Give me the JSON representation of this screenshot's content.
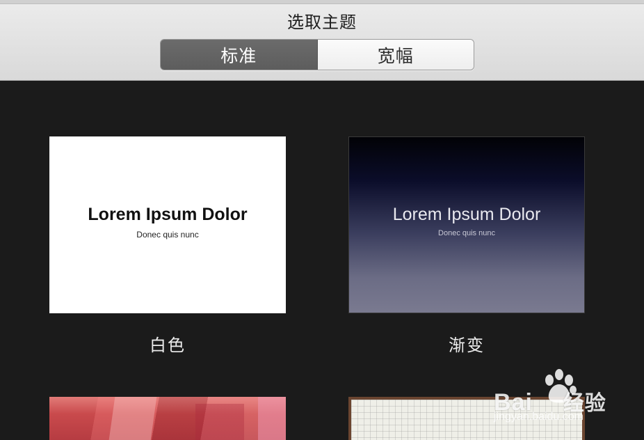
{
  "header": {
    "title": "选取主题",
    "segments": [
      {
        "label": "标准",
        "selected": true
      },
      {
        "label": "宽幅",
        "selected": false
      }
    ]
  },
  "themes": [
    {
      "name": "白色",
      "preview_title": "Lorem Ipsum Dolor",
      "preview_subtitle": "Donec quis nunc"
    },
    {
      "name": "渐变",
      "preview_title": "Lorem Ipsum Dolor",
      "preview_subtitle": "Donec quis nunc"
    }
  ],
  "watermark": {
    "brand_latin": "Bai",
    "brand_suffix": "经验",
    "url": "jingyan.baidu.com"
  }
}
